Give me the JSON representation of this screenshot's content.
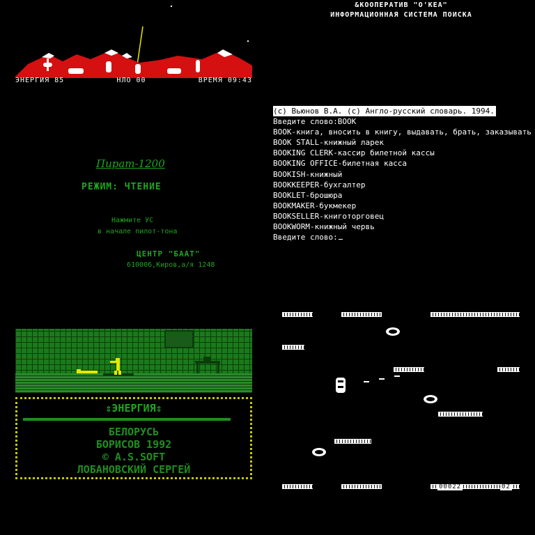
{
  "game_hud": {
    "energy": "ЭНЕРГИЯ 85",
    "ufo": "НЛО 00",
    "time": "ВРЕМЯ 09:43"
  },
  "dictionary": {
    "header1": "&КООПЕРАТИВ \"О'КЕА\"",
    "header2": "ИНФОРМАЦИОННАЯ СИСТЕМА ПОИСКА",
    "copyright": "(c) Вьюнов В.А.  (c) Англо-русский словарь.  1994.",
    "prompt": "Введите слово:",
    "query": "BOOK",
    "results": [
      "BOOK-книга, вносить в книгу, выдавать, брать, заказывать билет",
      "BOOK STALL-книжный ларек",
      "BOOKING CLERK-кассир билетной кассы",
      "BOOKING OFFICE-билетная касса",
      "BOOKISH-книжный",
      "BOOKKEEPER-бухгалтер",
      "BOOKLET-брошюра",
      "BOOKMAKER-букмекер",
      "BOOKSELLER-книготорговец",
      "BOOKWORM-книжный червь"
    ],
    "prompt2": "Введите слово:"
  },
  "loader": {
    "logo": "Пират-1200",
    "mode": "РЕЖИМ: ЧТЕНИЕ",
    "hint1": "Нажмите УС",
    "hint2": "в начале пилот-тона",
    "center": "ЦЕНТР \"БААТ\"",
    "address": "610006,Киров,а/я 1248"
  },
  "karate": {
    "title": "⇕ЭНЕРГИЯ⇕",
    "line1": "БЕЛОРУСЬ",
    "line2": "БОРИСОВ 1992",
    "line3": "© A.S.SOFT",
    "line4": "ЛОБАНОВСКИЙ СЕРГЕЙ"
  },
  "platform": {
    "score1": "00022",
    "score2": "02"
  },
  "colors": {
    "mountain_red": "#d41010",
    "loader_green": "#1ea61e",
    "border_yellow": "#c8c800"
  }
}
